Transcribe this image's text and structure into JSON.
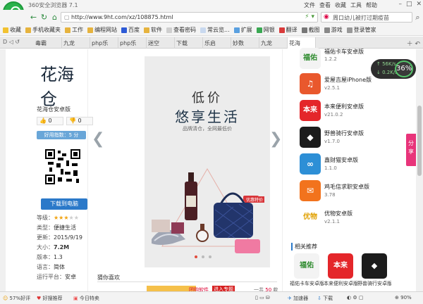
{
  "window": {
    "title": "360安全浏览器 7.1",
    "menu": [
      "文件",
      "查看",
      "收藏",
      "工具",
      "帮助"
    ]
  },
  "address": {
    "url": "http://www.9ht.com/xz/108875.html",
    "search_value": "周口幼儿被打过期疫苗"
  },
  "bookmarks": [
    "收藏",
    "手机收藏夹",
    "工作",
    "编程网站",
    "百度",
    "软件",
    "查看密码",
    "常云览...",
    "扩展",
    "网银",
    "翻译",
    "截图",
    "游戏",
    "登录管家"
  ],
  "tabs": [
    "毒霸",
    "九龙",
    "php乐",
    "php乐",
    "迷空",
    "下载",
    "乐启",
    "妙数",
    "九龙",
    "花海"
  ],
  "left": {
    "app_name": "花海仓安卓版",
    "up_count": "0",
    "down_count": "0",
    "rating_label": "好用指数：5 分",
    "download_label": "下载到电脑",
    "info": [
      {
        "k": "等级：",
        "v": ""
      },
      {
        "k": "类型：",
        "v": "便捷生活"
      },
      {
        "k": "更新：",
        "v": "2015/9/19"
      },
      {
        "k": "大小：",
        "v": "7.2M"
      },
      {
        "k": "版本：",
        "v": "1.3"
      },
      {
        "k": "语言：",
        "v": "简体"
      },
      {
        "k": "运行平台：",
        "v": "安卓"
      }
    ],
    "stars": 3
  },
  "gallery": {
    "title1": "低价",
    "title2": "悠享生活",
    "subtitle": "品牌清仓，全网最低价",
    "tag": "优惠特价",
    "logo_text": "花海仓"
  },
  "guess": {
    "title": "猜你喜欢",
    "tag1": "团购软件",
    "tag2": "进入专题",
    "count_prefix": "一共",
    "count": "50",
    "count_suffix": "款"
  },
  "right": {
    "apps": [
      {
        "name": "福佑卡车安卓版",
        "ver": "1.2.2",
        "color": "#f3f3f3",
        "fg": "#2e8b2e",
        "glyph": "福佑"
      },
      {
        "name": "爱屋吉屋iPhone版",
        "ver": "v2.5.1",
        "color": "#e9582d",
        "fg": "#ffffff",
        "glyph": "♫"
      },
      {
        "name": "本来便利安卓版",
        "ver": "v21.0.2",
        "color": "#e4262a",
        "fg": "#ffffff",
        "glyph": "本来"
      },
      {
        "name": "野兽骑行安卓版",
        "ver": "v1.7.0",
        "color": "#1c1c1c",
        "fg": "#ffffff",
        "glyph": "◆"
      },
      {
        "name": "鑫财猫安卓版",
        "ver": "1.1.0",
        "color": "#2d8fd6",
        "fg": "#ffffff",
        "glyph": "∞"
      },
      {
        "name": "鸡毛信求职安卓版",
        "ver": "3.78",
        "color": "#f2731d",
        "fg": "#ffffff",
        "glyph": "✉"
      },
      {
        "name": "优物安卓版",
        "ver": "v2.1.1",
        "color": "#ffffff",
        "fg": "#e0a000",
        "glyph": "优物"
      }
    ],
    "rec_title": "相关推荐",
    "recommend": [
      {
        "name": "福佑卡车安卓版",
        "color": "#f3f3f3",
        "fg": "#2e8b2e",
        "glyph": "福佑"
      },
      {
        "name": "本来便利安卓版v21.0.2",
        "color": "#e4262a",
        "fg": "#ffffff",
        "glyph": "本来"
      },
      {
        "name": "野兽骑行安卓版v1.7.0",
        "color": "#1c1c1c",
        "fg": "#ffffff",
        "glyph": "◆"
      }
    ]
  },
  "widget": {
    "up": "56K/s",
    "down": "0.2K/s",
    "percent": "36%",
    "share": "分享"
  },
  "status": {
    "item1": "57%好评",
    "item2": "好搜推荐",
    "item3": "今日特卖",
    "accel": "加速器",
    "download": "下载",
    "zoom": "90%"
  },
  "colors": {
    "accent_green": "#2bb24c",
    "download_blue": "#2b79c9",
    "share_pink": "#e8347a"
  }
}
